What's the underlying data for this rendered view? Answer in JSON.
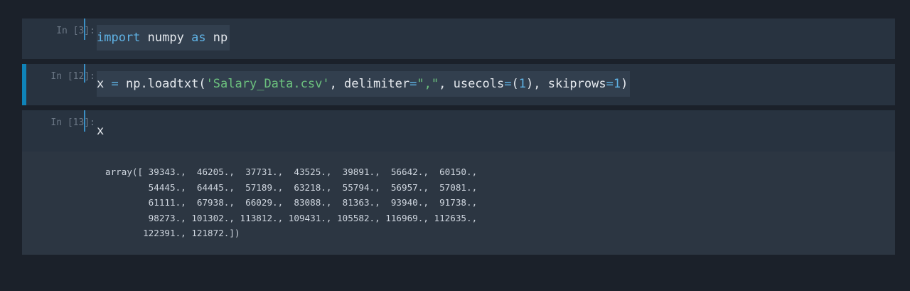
{
  "cells": [
    {
      "prompt": "In [3]:",
      "code": {
        "kw1": "import",
        "t1": " numpy ",
        "kw2": "as",
        "t2": " np"
      }
    },
    {
      "prompt": "In [12]:",
      "code": {
        "t1": "x ",
        "op1": "=",
        "t2": " np.loadtxt(",
        "s1": "'Salary_Data.csv'",
        "t3": ", delimiter",
        "op2": "=",
        "s2": "\",\"",
        "t4": ", usecols",
        "op3": "=",
        "t5": "(",
        "n1": "1",
        "t6": "), skiprows",
        "op4": "=",
        "n2": "1",
        "t7": ")"
      }
    },
    {
      "prompt": "In [13]:",
      "code": {
        "t1": "x"
      },
      "output": "array([ 39343.,  46205.,  37731.,  43525.,  39891.,  56642.,  60150.,\n        54445.,  64445.,  57189.,  63218.,  55794.,  56957.,  57081.,\n        61111.,  67938.,  66029.,  83088.,  81363.,  93940.,  91738.,\n        98273., 101302., 113812., 109431., 105582., 116969., 112635.,\n       122391., 121872.])"
    }
  ],
  "colors": {
    "background": "#1b212a",
    "cell": "#283340",
    "active_indicator": "#0f83b8",
    "keyword": "#5fb3e6",
    "string": "#6cc17e"
  }
}
